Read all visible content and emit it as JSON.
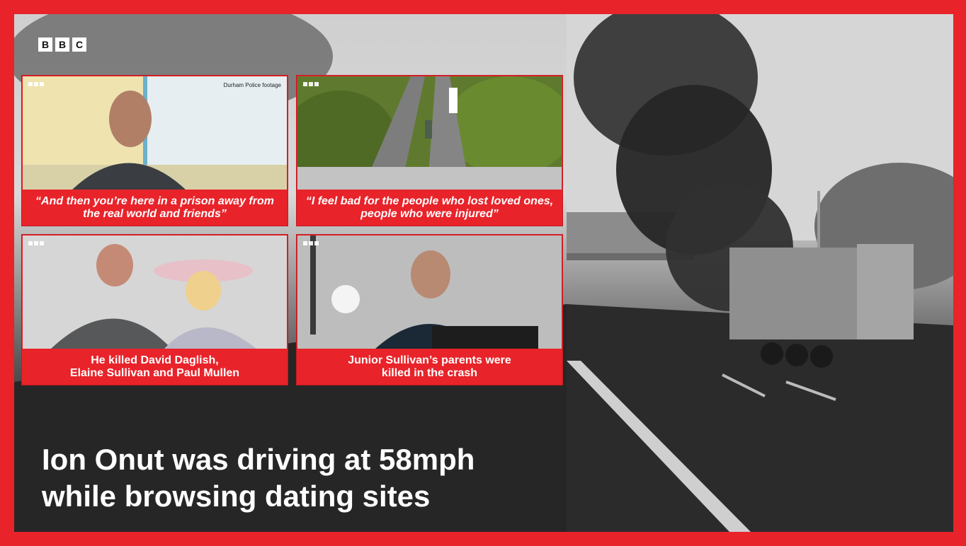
{
  "logo": {
    "letters": [
      "B",
      "B",
      "C"
    ]
  },
  "panels": [
    {
      "caption": "“And then you’re here in a prison away from the real world and friends”",
      "source_label": "Durham Police footage"
    },
    {
      "caption": "“I feel bad for the people who lost loved ones, people who were injured”"
    },
    {
      "caption_line1": "He killed David Daglish,",
      "caption_line2": "Elaine Sullivan and Paul Mullen"
    },
    {
      "caption_line1": "Junior Sullivan’s parents were",
      "caption_line2": "killed in the crash"
    }
  ],
  "headline": {
    "line1": "Ion Onut was driving at 58mph",
    "line2": "while browsing dating sites"
  },
  "colors": {
    "brand_red": "#e8232a",
    "text": "#ffffff"
  }
}
